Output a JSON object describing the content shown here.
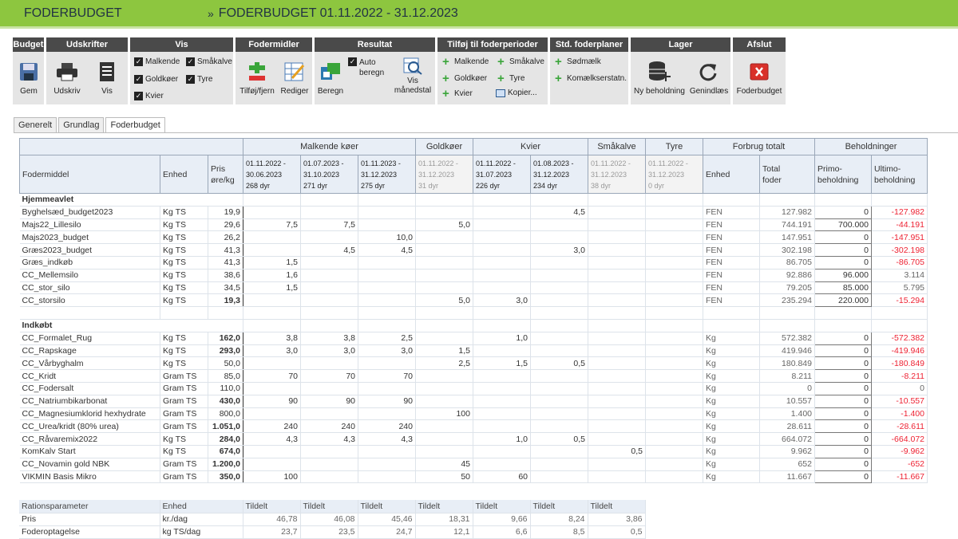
{
  "app_title": "FODERBUDGET",
  "page_title": "FODERBUDGET 01.11.2022 - 31.12.2023",
  "ribbon": {
    "budget": {
      "title": "Budget",
      "gem": "Gem"
    },
    "udskrifter": {
      "title": "Udskrifter",
      "udskriv": "Udskriv",
      "vis": "Vis"
    },
    "vis": {
      "title": "Vis",
      "malkende": "Malkende",
      "goldkoer": "Goldkøer",
      "kvier": "Kvier",
      "smaakalve": "Småkalve",
      "tyre": "Tyre"
    },
    "fodermidler": {
      "title": "Fodermidler",
      "tilfoej": "Tilføj/fjern",
      "rediger": "Rediger"
    },
    "resultat": {
      "title": "Resultat",
      "beregn": "Beregn",
      "auto1": "Auto",
      "auto2": "beregn",
      "vis1": "Vis",
      "vis2": "månedstal"
    },
    "tilfoej": {
      "title": "Tilføj til foderperioder",
      "malkende": "Malkende",
      "goldkoer": "Goldkøer",
      "kvier": "Kvier",
      "smaakalve": "Småkalve",
      "tyre": "Tyre",
      "kopier": "Kopier..."
    },
    "std": {
      "title": "Std. foderplaner",
      "soedmaelk": "Sødmælk",
      "komaelk": "Komælkserstatn."
    },
    "lager": {
      "title": "Lager",
      "ny": "Ny beholdning",
      "genindlaes": "Genindlæs"
    },
    "afslut": {
      "title": "Afslut",
      "foderbudget": "Foderbudget"
    }
  },
  "tabs": [
    "Generelt",
    "Grundlag",
    "Foderbudget"
  ],
  "table": {
    "groups": [
      "Malkende køer",
      "Goldkøer",
      "Kvier",
      "Småkalve",
      "Tyre",
      "Forbrug totalt",
      "Beholdninger"
    ],
    "headers": {
      "fodermiddel": "Fodermiddel",
      "enhed": "Enhed",
      "pris1": "Pris",
      "pris2": "øre/kg",
      "enhed2": "Enhed",
      "total1": "Total",
      "total2": "foder",
      "primo1": "Primo-",
      "primo2": "beholdning",
      "ultimo1": "Ultimo-",
      "ultimo2": "beholdning"
    },
    "periods": [
      {
        "d1": "01.11.2022 -",
        "d2": "30.06.2023",
        "d3": "268 dyr"
      },
      {
        "d1": "01.07.2023 -",
        "d2": "31.10.2023",
        "d3": "271 dyr"
      },
      {
        "d1": "01.11.2023 -",
        "d2": "31.12.2023",
        "d3": "275 dyr"
      },
      {
        "d1": "01.11.2022 -",
        "d2": "31.12.2023",
        "d3": "31 dyr"
      },
      {
        "d1": "01.11.2022 -",
        "d2": "31.07.2023",
        "d3": "226 dyr"
      },
      {
        "d1": "01.08.2023 -",
        "d2": "31.12.2023",
        "d3": "234 dyr"
      },
      {
        "d1": "01.11.2022 -",
        "d2": "31.12.2023",
        "d3": "38 dyr"
      },
      {
        "d1": "01.11.2022 -",
        "d2": "31.12.2023",
        "d3": "0 dyr"
      }
    ],
    "sections": [
      {
        "title": "Hjemmeavlet",
        "rows": [
          {
            "name": "Byghelsæd_budget2023",
            "unit": "Kg TS",
            "price": "19,9",
            "bold": false,
            "v": [
              "",
              "",
              "",
              "",
              "",
              "4,5",
              "",
              ""
            ],
            "u2": "FEN",
            "total": "127.982",
            "primo": "0",
            "ultimo": "-127.982"
          },
          {
            "name": "Majs22_Lillesilo",
            "unit": "Kg TS",
            "price": "29,6",
            "bold": false,
            "v": [
              "7,5",
              "7,5",
              "",
              "5,0",
              "",
              "",
              "",
              ""
            ],
            "u2": "FEN",
            "total": "744.191",
            "primo": "700.000",
            "ultimo": "-44.191"
          },
          {
            "name": "Majs2023_budget",
            "unit": "Kg TS",
            "price": "26,2",
            "bold": false,
            "v": [
              "",
              "",
              "10,0",
              "",
              "",
              "",
              "",
              ""
            ],
            "u2": "FEN",
            "total": "147.951",
            "primo": "0",
            "ultimo": "-147.951"
          },
          {
            "name": "Græs2023_budget",
            "unit": "Kg TS",
            "price": "41,3",
            "bold": false,
            "v": [
              "",
              "4,5",
              "4,5",
              "",
              "",
              "3,0",
              "",
              ""
            ],
            "u2": "FEN",
            "total": "302.198",
            "primo": "0",
            "ultimo": "-302.198"
          },
          {
            "name": "Græs_indkøb",
            "unit": "Kg TS",
            "price": "41,3",
            "bold": false,
            "v": [
              "1,5",
              "",
              "",
              "",
              "",
              "",
              "",
              ""
            ],
            "u2": "FEN",
            "total": "86.705",
            "primo": "0",
            "ultimo": "-86.705"
          },
          {
            "name": "CC_Mellemsilo",
            "unit": "Kg TS",
            "price": "38,6",
            "bold": false,
            "v": [
              "1,6",
              "",
              "",
              "",
              "",
              "",
              "",
              ""
            ],
            "u2": "FEN",
            "total": "92.886",
            "primo": "96.000",
            "ultimo": "3.114"
          },
          {
            "name": "CC_stor_silo",
            "unit": "Kg TS",
            "price": "34,5",
            "bold": false,
            "v": [
              "1,5",
              "",
              "",
              "",
              "",
              "",
              "",
              ""
            ],
            "u2": "FEN",
            "total": "79.205",
            "primo": "85.000",
            "ultimo": "5.795"
          },
          {
            "name": "CC_storsilo",
            "unit": "Kg TS",
            "price": "19,3",
            "bold": true,
            "v": [
              "",
              "",
              "",
              "5,0",
              "3,0",
              "",
              "",
              ""
            ],
            "u2": "FEN",
            "total": "235.294",
            "primo": "220.000",
            "ultimo": "-15.294"
          }
        ]
      },
      {
        "title": "Indkøbt",
        "rows": [
          {
            "name": "CC_Formalet_Rug",
            "unit": "Kg TS",
            "price": "162,0",
            "bold": true,
            "v": [
              "3,8",
              "3,8",
              "2,5",
              "",
              "1,0",
              "",
              "",
              ""
            ],
            "u2": "Kg",
            "total": "572.382",
            "primo": "0",
            "ultimo": "-572.382"
          },
          {
            "name": "CC_Rapskage",
            "unit": "Kg TS",
            "price": "293,0",
            "bold": true,
            "v": [
              "3,0",
              "3,0",
              "3,0",
              "1,5",
              "",
              "",
              "",
              ""
            ],
            "u2": "Kg",
            "total": "419.946",
            "primo": "0",
            "ultimo": "-419.946"
          },
          {
            "name": "CC_Vårbyghalm",
            "unit": "Kg TS",
            "price": "50,0",
            "bold": false,
            "v": [
              "",
              "",
              "",
              "2,5",
              "1,5",
              "0,5",
              "",
              ""
            ],
            "u2": "Kg",
            "total": "180.849",
            "primo": "0",
            "ultimo": "-180.849"
          },
          {
            "name": "CC_Kridt",
            "unit": "Gram TS",
            "price": "85,0",
            "bold": false,
            "v": [
              "70",
              "70",
              "70",
              "",
              "",
              "",
              "",
              ""
            ],
            "u2": "Kg",
            "total": "8.211",
            "primo": "0",
            "ultimo": "-8.211"
          },
          {
            "name": "CC_Fodersalt",
            "unit": "Gram TS",
            "price": "110,0",
            "bold": false,
            "v": [
              "",
              "",
              "",
              "",
              "",
              "",
              "",
              ""
            ],
            "u2": "Kg",
            "total": "0",
            "primo": "0",
            "ultimo": "0"
          },
          {
            "name": "CC_Natriumbikarbonat",
            "unit": "Gram TS",
            "price": "430,0",
            "bold": true,
            "v": [
              "90",
              "90",
              "90",
              "",
              "",
              "",
              "",
              ""
            ],
            "u2": "Kg",
            "total": "10.557",
            "primo": "0",
            "ultimo": "-10.557"
          },
          {
            "name": "CC_Magnesiumklorid hexhydrate",
            "unit": "Gram TS",
            "price": "800,0",
            "bold": false,
            "v": [
              "",
              "",
              "",
              "100",
              "",
              "",
              "",
              ""
            ],
            "u2": "Kg",
            "total": "1.400",
            "primo": "0",
            "ultimo": "-1.400"
          },
          {
            "name": "CC_Urea/kridt  (80% urea)",
            "unit": "Gram TS",
            "price": "1.051,0",
            "bold": true,
            "v": [
              "240",
              "240",
              "240",
              "",
              "",
              "",
              "",
              ""
            ],
            "u2": "Kg",
            "total": "28.611",
            "primo": "0",
            "ultimo": "-28.611"
          },
          {
            "name": "CC_Råvaremix2022",
            "unit": "Kg TS",
            "price": "284,0",
            "bold": true,
            "v": [
              "4,3",
              "4,3",
              "4,3",
              "",
              "1,0",
              "0,5",
              "",
              ""
            ],
            "u2": "Kg",
            "total": "664.072",
            "primo": "0",
            "ultimo": "-664.072"
          },
          {
            "name": "KomKalv Start",
            "unit": "Kg TS",
            "price": "674,0",
            "bold": true,
            "v": [
              "",
              "",
              "",
              "",
              "",
              "",
              "0,5",
              ""
            ],
            "u2": "Kg",
            "total": "9.962",
            "primo": "0",
            "ultimo": "-9.962"
          },
          {
            "name": "CC_Novamin gold NBK",
            "unit": "Gram TS",
            "price": "1.200,0",
            "bold": true,
            "v": [
              "",
              "",
              "",
              "45",
              "",
              "",
              "",
              ""
            ],
            "u2": "Kg",
            "total": "652",
            "primo": "0",
            "ultimo": "-652"
          },
          {
            "name": "VIKMIN Basis Mikro",
            "unit": "Gram TS",
            "price": "350,0",
            "bold": true,
            "v": [
              "100",
              "",
              "",
              "50",
              "60",
              "",
              "",
              ""
            ],
            "u2": "Kg",
            "total": "11.667",
            "primo": "0",
            "ultimo": "-11.667"
          }
        ]
      }
    ]
  },
  "rations": {
    "headers": [
      "Rationsparameter",
      "Enhed",
      "Tildelt",
      "Tildelt",
      "Tildelt",
      "Tildelt",
      "Tildelt",
      "Tildelt",
      "Tildelt"
    ],
    "rows": [
      {
        "name": "Pris",
        "unit": "kr./dag",
        "v": [
          "46,78",
          "46,08",
          "45,46",
          "18,31",
          "9,66",
          "8,24",
          "3,86"
        ]
      },
      {
        "name": "Foderoptagelse",
        "unit": "kg TS/dag",
        "v": [
          "23,7",
          "23,5",
          "24,7",
          "12,1",
          "6,6",
          "8,5",
          "0,5"
        ]
      }
    ]
  },
  "colors": {
    "header": "#8dc63f",
    "ribbon_title": "#4a4a4a",
    "negative": "#e22233"
  }
}
